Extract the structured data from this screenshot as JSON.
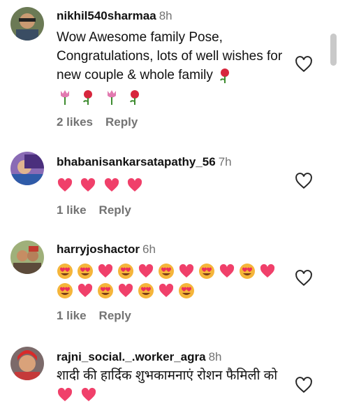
{
  "comments": [
    {
      "username": "nikhil540sharmaa",
      "time": "8h",
      "text": "Wow Awesome family Pose, Congratulations, lots of well wishes for new couple & whole family",
      "emoji_line": [
        "tulip",
        "rose",
        "tulip",
        "rose"
      ],
      "likes": "2 likes",
      "reply": "Reply"
    },
    {
      "username": "bhabanisankarsatapathy_56",
      "time": "7h",
      "text": "",
      "emoji_line": [
        "heart",
        "heart",
        "heart",
        "heart"
      ],
      "likes": "1 like",
      "reply": "Reply"
    },
    {
      "username": "harryjoshactor",
      "time": "6h",
      "text": "",
      "emoji_line1": [
        "heart-eyes",
        "heart-eyes",
        "heart",
        "heart-eyes",
        "heart",
        "heart-eyes",
        "heart",
        "heart-eyes",
        "heart",
        "heart-eyes",
        "heart"
      ],
      "emoji_line2": [
        "heart-eyes",
        "heart",
        "heart-eyes",
        "heart",
        "heart-eyes",
        "heart",
        "heart-eyes"
      ],
      "likes": "1 like",
      "reply": "Reply"
    },
    {
      "username": "rajni_social._.worker_agra",
      "time": "8h",
      "text": "शादी की हार्दिक शुभकामनाएं रोशन फैमिली को",
      "emoji_line": [
        "heart",
        "heart"
      ]
    }
  ],
  "colors": {
    "heart": "#f0406a",
    "username": "#111111",
    "meta": "#737373"
  }
}
